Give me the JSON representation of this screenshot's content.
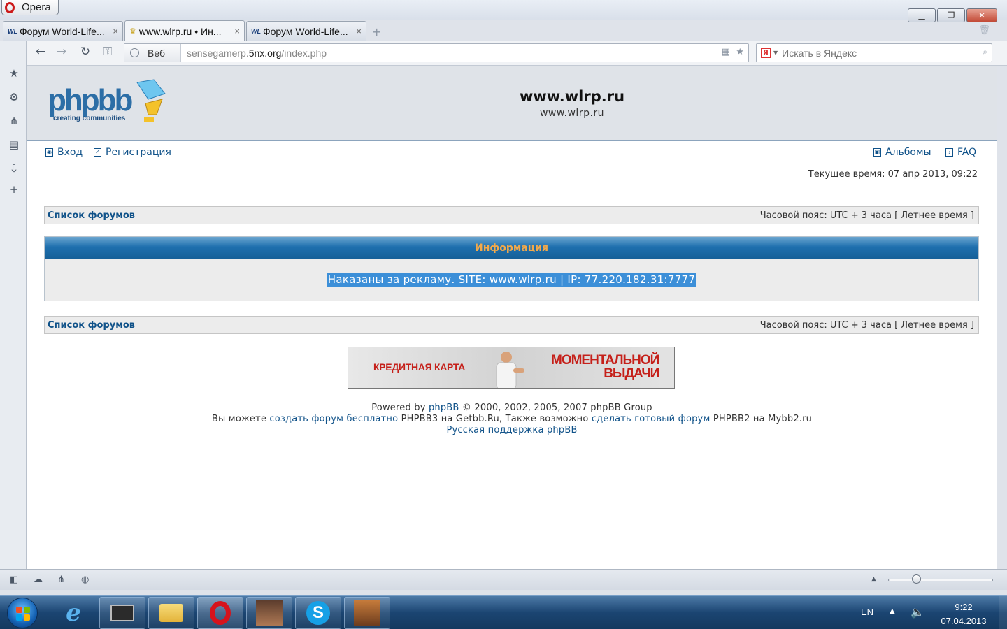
{
  "browser": {
    "menu_label": "Opera",
    "tabs": [
      {
        "favicon": "WL",
        "title": "Форум World-Life...",
        "close": "×"
      },
      {
        "favicon": "",
        "title": "www.wlrp.ru • Ин...",
        "close": "×"
      },
      {
        "favicon": "WL",
        "title": "Форум World-Life...",
        "close": "×"
      }
    ],
    "address": {
      "badge": "Веб",
      "url_prefix": "sensegamerp.",
      "url_domain": "5nx.org",
      "url_path": "/index.php"
    },
    "search": {
      "placeholder": "Искать в Яндекс"
    },
    "zoom_level": 0.25
  },
  "forum": {
    "site_title": "www.wlrp.ru",
    "site_description": "www.wlrp.ru",
    "logo_text": "phpbb",
    "logo_tagline": "creating communities",
    "nav": {
      "login": "Вход",
      "register": "Регистрация",
      "albums": "Альбомы",
      "faq": "FAQ"
    },
    "current_time": "Текущее время: 07 апр 2013, 09:22",
    "forums_link": "Список форумов",
    "timezone": "Часовой пояс: UTC + 3 часа [ Летнее время ]",
    "info": {
      "heading": "Информация",
      "message": "Наказаны за рекламу. SITE: www.wlrp.ru | IP: 77.220.182.31:7777"
    },
    "banner": {
      "left_text": "КРЕДИТНАЯ КАРТА",
      "right_line1": "МОМЕНТАЛЬНОЙ",
      "right_line2": "ВЫДАЧИ"
    },
    "footer": {
      "powered_pre": "Powered by",
      "powered_link": "phpBB",
      "powered_post": "© 2000, 2002, 2005, 2007 phpBB Group",
      "line2_a": "Вы можете",
      "line2_link1": "создать форум бесплатно",
      "line2_b": "PHPBB3 на Getbb.Ru, Также возможно",
      "line2_link2": "сделать готовый форум",
      "line2_c": "PHPBB2 на Mybb2.ru",
      "support_link": "Русская поддержка phpBB"
    }
  },
  "taskbar": {
    "language": "EN",
    "time": "9:22",
    "date": "07.04.2013"
  }
}
